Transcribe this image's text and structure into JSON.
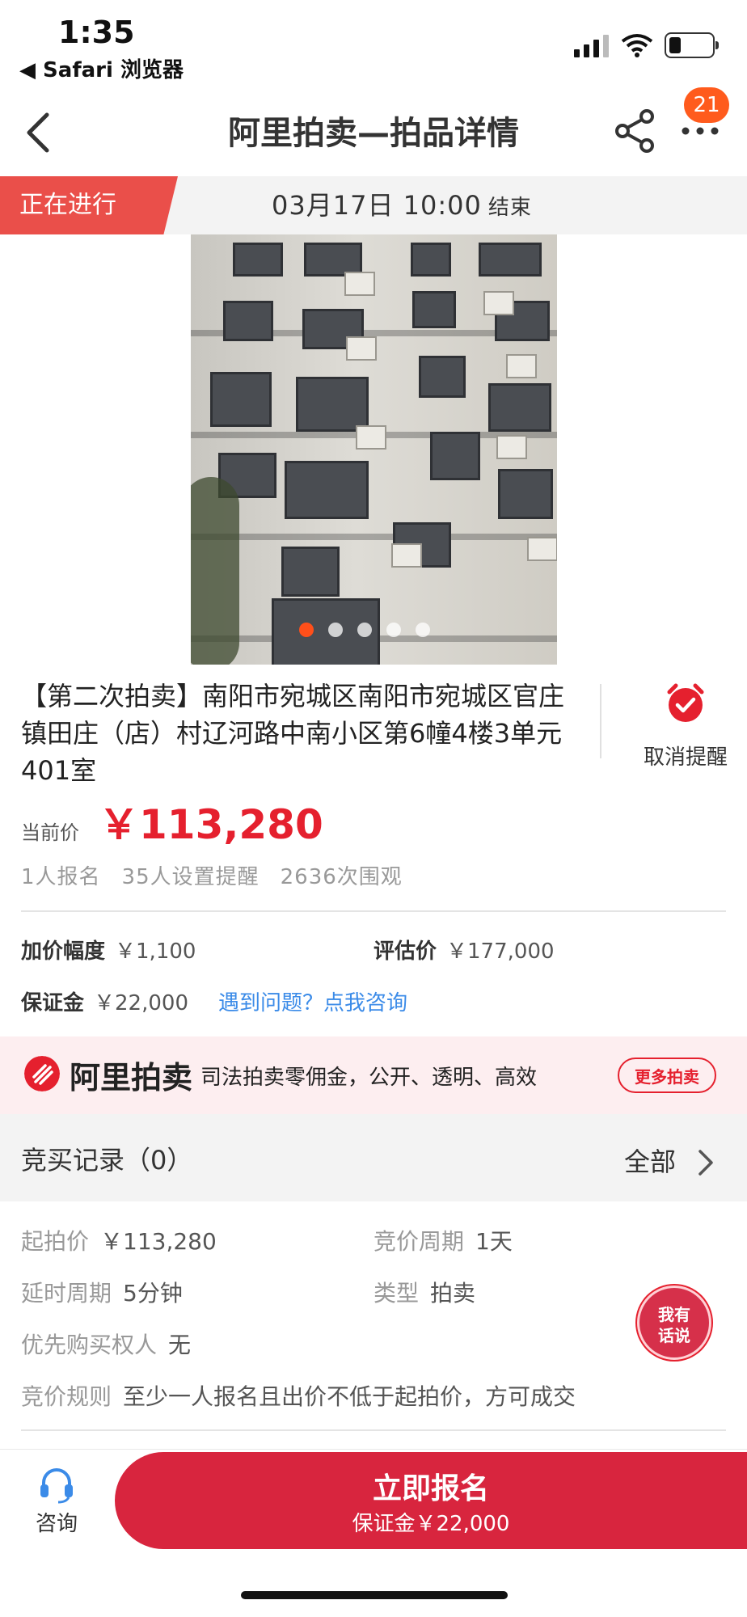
{
  "status_bar": {
    "time": "1:35",
    "back_app": "◀ Safari 浏览器"
  },
  "nav": {
    "title": "阿里拍卖—拍品详情",
    "badge_count": "21"
  },
  "auction_status": {
    "label": "正在进行",
    "end_time": "03月17日  10:00",
    "end_suffix": "结束"
  },
  "gallery": {
    "total": 5,
    "active_index": 0
  },
  "item": {
    "title": "【第二次拍卖】南阳市宛城区南阳市宛城区官庄镇田庄（店）村辽河路中南小区第6幢4楼3单元401室",
    "reminder_label": "取消提醒",
    "current_price_label": "当前价",
    "current_price": "￥113,280",
    "stats": [
      "1人报名",
      "35人设置提醒",
      "2636次围观"
    ]
  },
  "pricing": {
    "increment_label": "加价幅度",
    "increment_value": "￥1,100",
    "appraisal_label": "评估价",
    "appraisal_value": "￥177,000",
    "deposit_label": "保证金",
    "deposit_value": "￥22,000",
    "consult_link": "遇到问题？点我咨询"
  },
  "promo": {
    "brand": "阿里拍卖",
    "slogan": "司法拍卖零佣金，公开、透明、高效",
    "more_button": "更多拍卖"
  },
  "records": {
    "title": "竞买记录（0）",
    "all_label": "全部"
  },
  "details": {
    "start_price_label": "起拍价",
    "start_price_value": "￥113,280",
    "cycle_label": "竞价周期",
    "cycle_value": "1天",
    "delay_label": "延时周期",
    "delay_value": "5分钟",
    "type_label": "类型",
    "type_value": "拍卖",
    "priority_label": "优先购买权人",
    "priority_value": "无",
    "rule_label": "竞价规则",
    "rule_value": "至少一人报名且出价不低于起拍价，方可成交"
  },
  "float_button": {
    "line1": "我有",
    "line2": "话说"
  },
  "bottom_bar": {
    "consult_label": "咨询",
    "cta_main": "立即报名",
    "cta_sub": "保证金￥22,000"
  },
  "colors": {
    "accent": "#e5202e",
    "ribbon": "#ea4f4a",
    "badge": "#ff5b1d",
    "link": "#3b8be8"
  }
}
